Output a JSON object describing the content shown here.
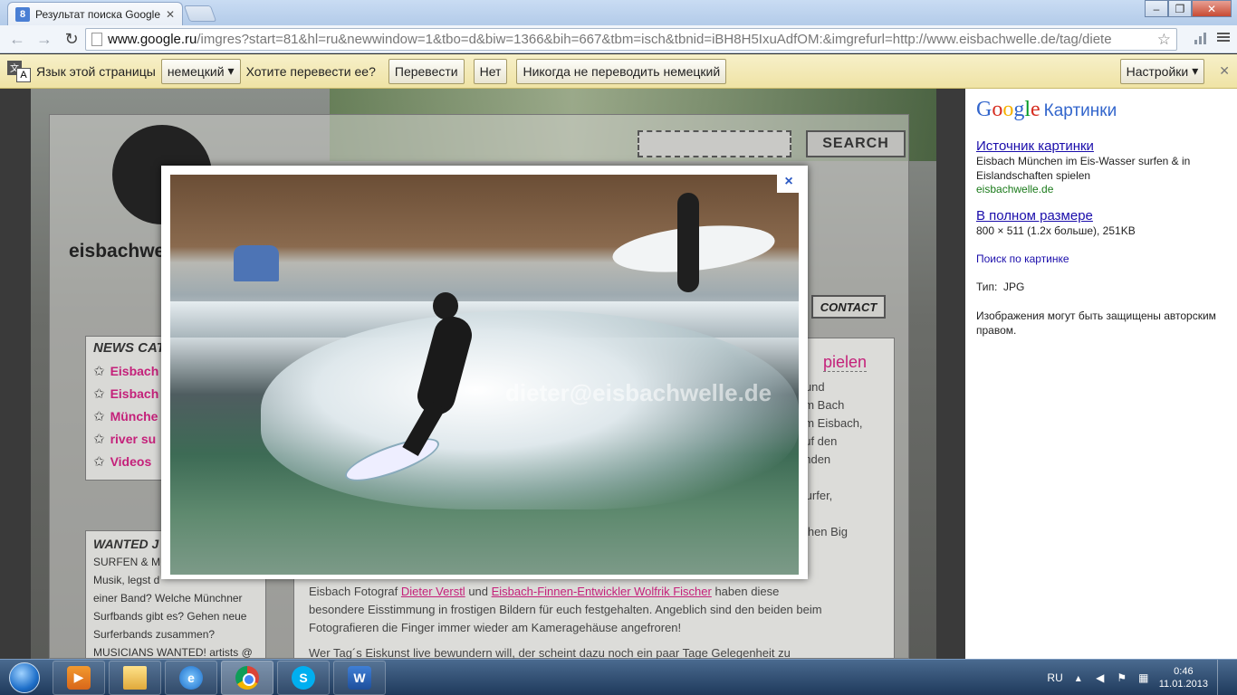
{
  "browser": {
    "tab_title": "Результат поиска Google",
    "tab_favicon": "8",
    "url_host": "www.google.ru",
    "url_path": "/imgres?start=81&hl=ru&newwindow=1&tbo=d&biw=1366&bih=667&tbm=isch&tbnid=iBH8H5IxuAdfOM:&imgrefurl=http://www.eisbachwelle.de/tag/diete"
  },
  "translate_bar": {
    "label": "Язык этой страницы",
    "language": "немецкий",
    "question": "Хотите перевести ее?",
    "translate_btn": "Перевести",
    "no_btn": "Нет",
    "never_btn": "Никогда не переводить немецкий",
    "settings_btn": "Настройки"
  },
  "site": {
    "logo_text": "eisbachwe",
    "search_btn": "SEARCH",
    "contact": "CONTACT",
    "news_title": "NEWS CAT",
    "news_items": [
      "Eisbach",
      "Eisbach",
      "Münche",
      "river su",
      "Videos"
    ],
    "wanted_title": "WANTED J",
    "wanted_lines": [
      "SURFEN & MU",
      "Musik, legst d",
      "einer Band? Welche Münchner",
      "Surfbands gibt es? Gehen neue",
      "Surferbands zusammen?",
      "MUSICIANS WANTED! artists @"
    ],
    "article_heading": "pielen",
    "article_right": [
      "r und",
      "em Bach",
      "am Eisbach,",
      "auf den",
      "enden",
      "",
      "Surfer,",
      "",
      "tehen Big"
    ],
    "article_bottom_1a": "Eisbach Fotograf ",
    "article_bottom_link1": "Dieter Verstl",
    "article_bottom_1b": " und ",
    "article_bottom_link2": "Eisbach-Finnen-Entwickler Wolfrik Fischer",
    "article_bottom_1c": " haben diese",
    "article_bottom_2": "besondere Eisstimmung in frostigen Bildern für euch festgehalten. Angeblich sind den beiden beim",
    "article_bottom_3": "Fotografieren die Finger immer wieder am Kameragehäuse angefroren!",
    "article_bottom_4": "Wer Tag´s Eiskunst live bewundern will, der scheint dazu noch ein paar Tage Gelegenheit zu"
  },
  "lightbox": {
    "watermark": "dieter@eisbachwelle.de",
    "close": "×"
  },
  "side_panel": {
    "logo_word": "Картинки",
    "source_link": "Источник картинки",
    "source_desc": "Eisbach München im Eis-Wasser surfen & in Eislandschaften spielen",
    "source_domain": "eisbachwelle.de",
    "fullsize_link": "В полном размере",
    "fullsize_desc": "800 × 511 (1.2x больше), 251KB",
    "search_by_image": "Поиск по картинке",
    "type_label": "Тип:",
    "type_value": "JPG",
    "copyright": "Изображения могут быть защищены авторским правом."
  },
  "taskbar": {
    "lang": "RU",
    "time": "0:46",
    "date": "11.01.2013",
    "ie_glyph": "e",
    "skype_glyph": "S",
    "word_glyph": "W"
  },
  "colors": {
    "link": "#1a0dab",
    "green_url": "#1a7a1a",
    "site_pink": "#c4217a"
  }
}
